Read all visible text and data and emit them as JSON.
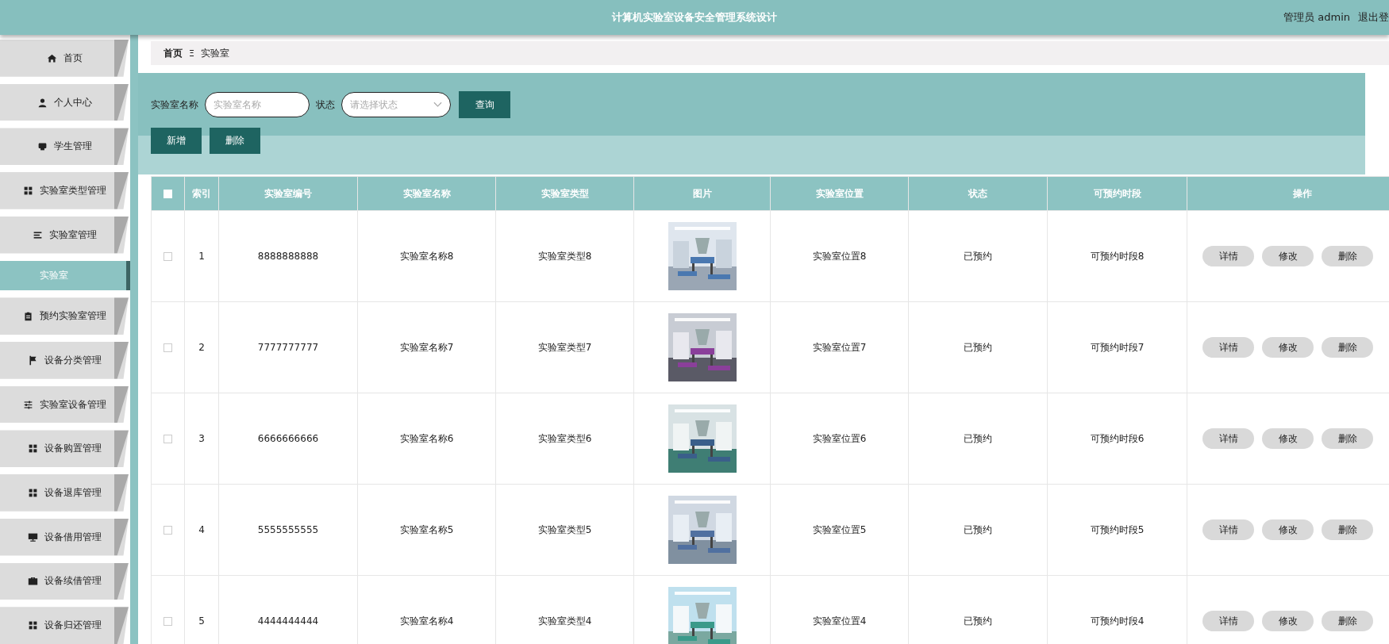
{
  "header": {
    "title": "计算机实验室设备安全管理系统设计",
    "user": "管理员 admin",
    "logout": "退出登"
  },
  "sidebar": {
    "items": [
      {
        "label": "首页",
        "selected": false
      },
      {
        "label": "个人中心",
        "selected": false
      },
      {
        "label": "学生管理",
        "selected": false
      },
      {
        "label": "实验室类型管理",
        "selected": false
      },
      {
        "label": "实验室管理",
        "selected": false,
        "children": [
          {
            "label": "实验室",
            "selected": true
          }
        ]
      },
      {
        "label": "预约实验室管理",
        "selected": false
      },
      {
        "label": "设备分类管理",
        "selected": false
      },
      {
        "label": "实验室设备管理",
        "selected": false
      },
      {
        "label": "设备购置管理",
        "selected": false
      },
      {
        "label": "设备退库管理",
        "selected": false
      },
      {
        "label": "设备借用管理",
        "selected": false
      },
      {
        "label": "设备续借管理",
        "selected": false
      },
      {
        "label": "设备归还管理",
        "selected": false
      }
    ]
  },
  "breadcrumb": {
    "home": "首页",
    "separator": "Ξ",
    "current": "实验室"
  },
  "search": {
    "name_label": "实验室名称",
    "name_placeholder": "实验室名称",
    "status_label": "状态",
    "status_placeholder": "请选择状态",
    "query_button": "查询"
  },
  "actions": [
    "新增",
    "删除"
  ],
  "table": {
    "select_all": {
      "checked": false
    },
    "columns": [
      "索引",
      "实验室编号",
      "实验室名称",
      "实验室类型",
      "图片",
      "实验室位置",
      "状态",
      "可预约时段",
      "操作"
    ],
    "rows": [
      {
        "checked": false,
        "index": "1",
        "code": "8888888888",
        "name": "实验室名称8",
        "type": "实验室类型8",
        "location": "实验室位置8",
        "status": "已预约",
        "slot": "可预约时段8",
        "buttons": [
          "详情",
          "修改",
          "删除"
        ]
      },
      {
        "checked": false,
        "index": "2",
        "code": "7777777777",
        "name": "实验室名称7",
        "type": "实验室类型7",
        "location": "实验室位置7",
        "status": "已预约",
        "slot": "可预约时段7",
        "buttons": [
          "详情",
          "修改",
          "删除"
        ]
      },
      {
        "checked": false,
        "index": "3",
        "code": "6666666666",
        "name": "实验室名称6",
        "type": "实验室类型6",
        "location": "实验室位置6",
        "status": "已预约",
        "slot": "可预约时段6",
        "buttons": [
          "详情",
          "修改",
          "删除"
        ]
      },
      {
        "checked": false,
        "index": "4",
        "code": "5555555555",
        "name": "实验室名称5",
        "type": "实验室类型5",
        "location": "实验室位置5",
        "status": "已预约",
        "slot": "可预约时段5",
        "buttons": [
          "详情",
          "修改",
          "删除"
        ]
      },
      {
        "checked": false,
        "index": "5",
        "code": "4444444444",
        "name": "实验室名称4",
        "type": "实验室类型4",
        "location": "实验室位置4",
        "status": "已预约",
        "slot": "可预约时段4",
        "buttons": [
          "详情",
          "修改",
          "删除"
        ]
      }
    ]
  }
}
